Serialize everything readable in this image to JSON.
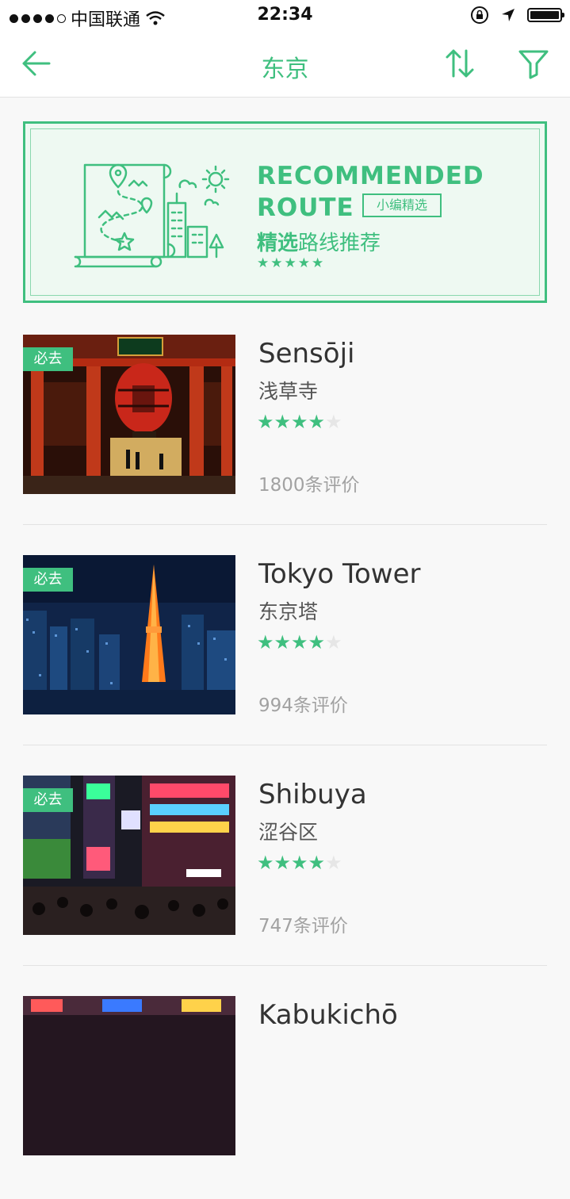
{
  "status": {
    "carrier": "中国联通",
    "time": "22:34"
  },
  "nav": {
    "title": "东京",
    "back_icon": "arrow-left-icon",
    "sort_icon": "sort-icon",
    "filter_icon": "filter-icon"
  },
  "banner": {
    "title_line1": "RECOMMENDED",
    "title_line2": "ROUTE",
    "tag": "小编精选",
    "cn_bold": "精选",
    "cn_rest": "路线推荐",
    "stars": "★★★★★"
  },
  "colors": {
    "accent": "#3fbf7f",
    "star_off": "#e6e6e6"
  },
  "places": [
    {
      "badge": "必去",
      "name": "Sensōji",
      "cn": "浅草寺",
      "rating": 4,
      "reviews": "1800条评价"
    },
    {
      "badge": "必去",
      "name": "Tokyo Tower",
      "cn": "东京塔",
      "rating": 4,
      "reviews": "994条评价"
    },
    {
      "badge": "必去",
      "name": "Shibuya",
      "cn": "涩谷区",
      "rating": 4,
      "reviews": "747条评价"
    },
    {
      "badge": "",
      "name": "Kabukichō",
      "cn": "",
      "rating": 0,
      "reviews": ""
    }
  ]
}
